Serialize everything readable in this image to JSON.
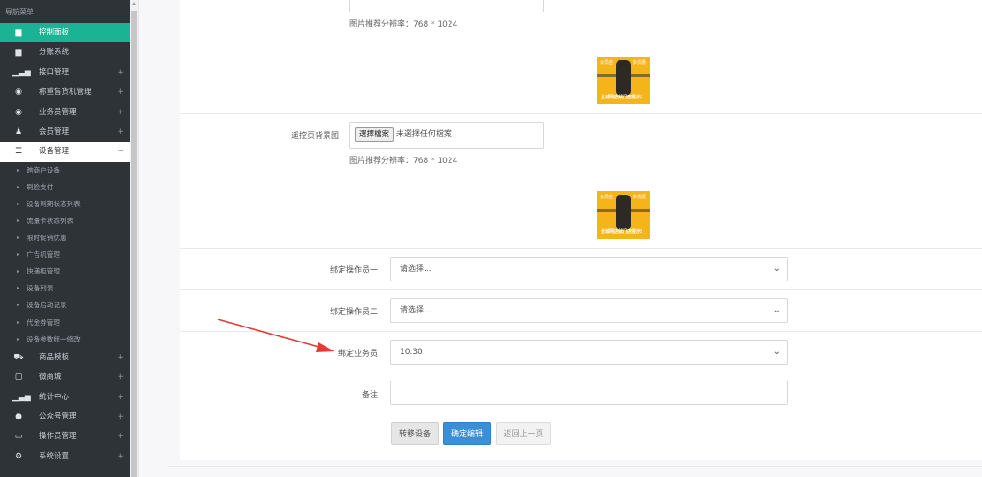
{
  "sidebar": {
    "header": "导航菜单",
    "items_top": [
      {
        "label": "控制面板",
        "icon": "dashboard-icon",
        "glyph": "▆",
        "active": true
      },
      {
        "label": "分账系统",
        "icon": "grid-icon",
        "glyph": "▆"
      },
      {
        "label": "接口管理",
        "icon": "bar-chart-icon",
        "glyph": "▁▃▅",
        "plus": "+"
      },
      {
        "label": "称重售货机管理",
        "icon": "circle-arrow-icon",
        "glyph": "◉",
        "plus": "+"
      },
      {
        "label": "业务员管理",
        "icon": "circle-arrow-icon",
        "glyph": "◉",
        "plus": "+"
      },
      {
        "label": "会员管理",
        "icon": "user-icon",
        "glyph": "♟",
        "plus": "+"
      },
      {
        "label": "设备管理",
        "icon": "list-icon",
        "glyph": "☰",
        "plus": "−",
        "open": true
      }
    ],
    "sub_items": [
      "跨商户设备",
      "刷脸支付",
      "设备到期状态列表",
      "流量卡状态列表",
      "限时促销优惠",
      "广告机管理",
      "快递柜管理",
      "设备列表",
      "设备启动记录",
      "代金券管理",
      "设备参数统一修改"
    ],
    "items_bottom": [
      {
        "label": "商品模板",
        "icon": "cart-icon",
        "glyph": "⛟",
        "plus": "+"
      },
      {
        "label": "微商城",
        "icon": "square-icon",
        "glyph": "▢",
        "plus": "+"
      },
      {
        "label": "统计中心",
        "icon": "bar-chart-icon",
        "glyph": "▁▃▅",
        "plus": "+"
      },
      {
        "label": "公众号管理",
        "icon": "wechat-icon",
        "glyph": "●",
        "plus": "+"
      },
      {
        "label": "操作员管理",
        "icon": "monitor-icon",
        "glyph": "▭",
        "plus": "+"
      },
      {
        "label": "系统设置",
        "icon": "gears-icon",
        "glyph": "⚙",
        "plus": "+"
      }
    ]
  },
  "form": {
    "hint1": "图片推荐分辨率：768 * 1024",
    "bg_label": "遥控页背景图",
    "file_button": "選擇檔案",
    "file_status": "未選擇任何檔案",
    "hint2": "图片推荐分辨率：768 * 1024",
    "operator1_label": "绑定操作员一",
    "operator1_value": "请选择...",
    "operator2_label": "绑定操作员二",
    "operator2_value": "请选择...",
    "salesman_label": "绑定业务员",
    "salesman_value": "10.30",
    "remark_label": "备注",
    "remark_value": "",
    "thumb_text_left": "会员店",
    "thumb_text_right": "多优惠",
    "thumb_text_bottom": "全城网店就门店提示!"
  },
  "buttons": {
    "transfer": "转移设备",
    "confirm": "确定编辑",
    "back": "返回上一页"
  },
  "colors": {
    "sidebar_bg": "#2e3338",
    "active": "#1ab394",
    "primary": "#3a8fd6",
    "arrow": "#e53935"
  }
}
